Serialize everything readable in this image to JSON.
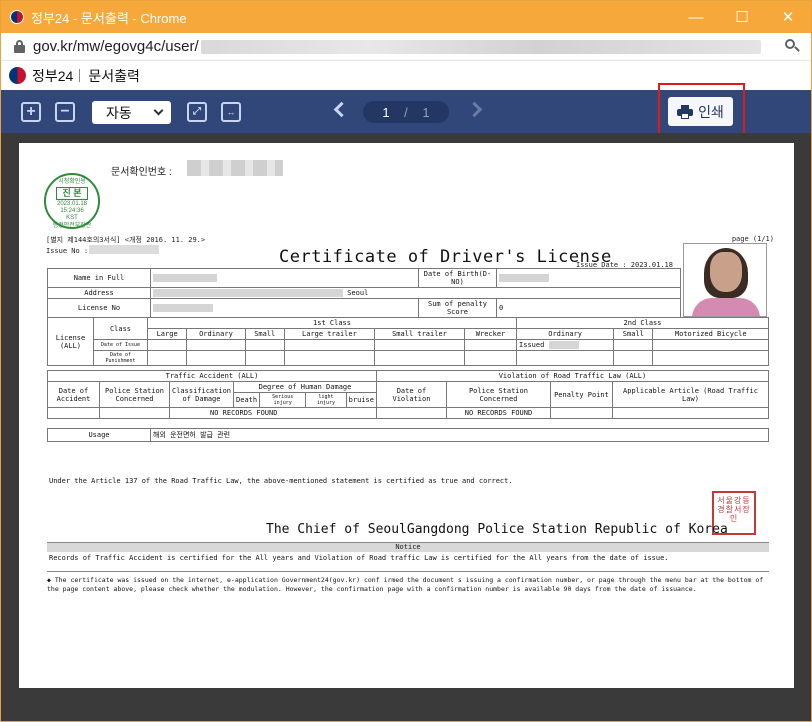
{
  "window": {
    "title": "정부24 - 문서출력 - Chrome",
    "controls": {
      "minimize": "—",
      "maximize": "☐",
      "close": "✕"
    }
  },
  "address_bar": {
    "url": "gov.kr/mw/egovg4c/user/"
  },
  "site": {
    "name": "정부24",
    "page": "문서출력"
  },
  "toolbar": {
    "zoom_in": "+",
    "zoom_out": "−",
    "zoom_value": "자동",
    "current_page": "1",
    "page_separator": "/",
    "total_pages": "1",
    "print_label": "인쇄"
  },
  "document": {
    "doc_id_label": "문서확인번호 :",
    "seal": {
      "top": "시청확인용",
      "main": "진 본",
      "date": "2023.01.18",
      "time": "15:24:36",
      "tz": "KST",
      "bottom": "행정안전부장관"
    },
    "form_label": "[별지 제144호의3서식] <개정 2016. 11. 29.>",
    "page_label": "page (1/1)",
    "issue_no_label": "Issue No :",
    "title": "Certificate of Driver's License",
    "issue_date": "Issue Date : 2023.01.18",
    "rows": {
      "name": "Name in Full",
      "dob": "Date of Birth(D-NO)",
      "address": "Address",
      "address_city": "Seoul",
      "license_no": "License No",
      "penalty": "Sum of penalty Score",
      "penalty_value": "0"
    },
    "license": {
      "label": "License (ALL)",
      "class": "Class",
      "first_class": "1st Class",
      "second_class": "2nd Class",
      "classes": [
        "Large",
        "Ordinary",
        "Small",
        "Large trailer",
        "Small trailer",
        "Wrecker",
        "Ordinary",
        "Small",
        "Motorized Bicycle"
      ],
      "date_issue": "Date of Issue",
      "date_punish": "Date of Punishment",
      "issued": "Issued"
    },
    "accident": {
      "header": "Traffic Accident (ALL)",
      "violation_header": "Violation of Road Traffic Law (ALL)",
      "cols": [
        "Date of Accident",
        "Police Station Concerned",
        "Classification of Damage",
        "Degree of Human Damage",
        "Date of Violation",
        "Police Station Concerned",
        "Penalty Point",
        "Applicable Article (Road Traffic Law)"
      ],
      "damage_cols": [
        "Death",
        "Serious injury",
        "light injury",
        "bruise"
      ],
      "no_records": "NO RECORDS FOUND"
    },
    "usage": {
      "label": "Usage",
      "value": "해외 운전면허 발급 관련"
    },
    "article": "Under the Article 137 of the Road Traffic Law, the above-mentioned statement is certified as true and correct.",
    "red_seal": "서울강동 경찰서장 인",
    "chief": "The Chief of SeoulGangdong Police Station Republic of Korea",
    "notice_title": "Notice",
    "notice": "Records of Traffic Accident is certified for the All years and Violation of Road traffic Law is certified for the All years from the date of issue.",
    "footnote": "◆ The certificate was issued on the internet, e-application Government24(gov.kr) conf irmed the document s issuing a confirmation number, or page through the menu bar at the bottom of the page content above, please check whether the modulation. However, the confirmation page with a confirmation number is available 90 days from the date of issuance."
  },
  "colors": {
    "toolbar": "#31477a",
    "titlebar": "#f6a83a",
    "highlight": "#e0191a"
  }
}
